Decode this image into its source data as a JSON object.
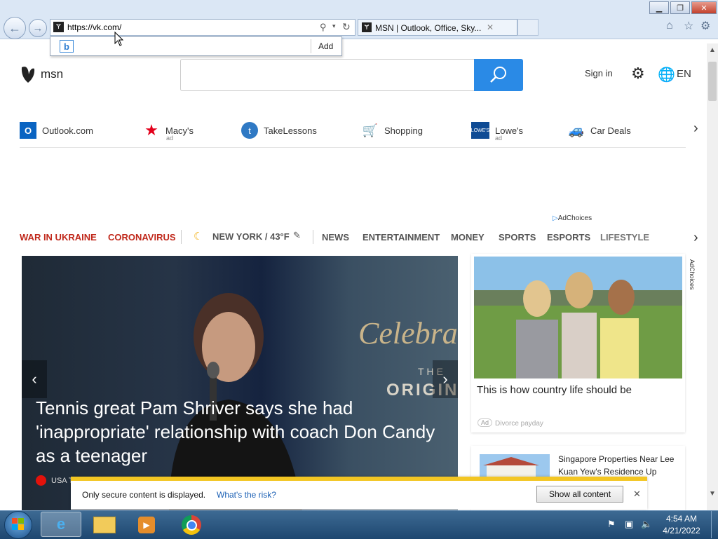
{
  "browser": {
    "address_url": "https://vk.com/",
    "tab_title": "MSN | Outlook, Office, Sky...",
    "suggest_add_label": "Add",
    "window_controls": [
      "minimize",
      "maximize",
      "close"
    ]
  },
  "msn": {
    "logo_text": "msn",
    "search_placeholder": "",
    "sign_in": "Sign in",
    "language": "EN",
    "quick_links": [
      {
        "label": "Outlook.com",
        "ad": ""
      },
      {
        "label": "Macy's",
        "ad": "ad"
      },
      {
        "label": "TakeLessons",
        "ad": ""
      },
      {
        "label": "Shopping",
        "ad": ""
      },
      {
        "label": "Lowe's",
        "ad": "ad"
      },
      {
        "label": "Car Deals",
        "ad": ""
      }
    ],
    "adchoices": "AdChoices",
    "nav": {
      "war": "WAR IN UKRAINE",
      "corona": "CORONAVIRUS",
      "weather": "NEW YORK / 43°F",
      "news": "NEWS",
      "entertainment": "ENTERTAINMENT",
      "money": "MONEY",
      "sports": "SPORTS",
      "esports": "ESPORTS",
      "lifestyle": "LIFESTYLE"
    },
    "hero": {
      "headline": "Tennis great Pam Shriver says she had 'inappropriate' relationship with coach Don Candy as a teenager",
      "source": "USA T",
      "backdrop_text": "Celebra",
      "backdrop_sub": "THE",
      "backdrop_sub2": "ORIGIN"
    },
    "card1": {
      "title": "This is how country life should be",
      "ad_badge": "Ad",
      "source": "Divorce payday"
    },
    "card2": {
      "title": "Singapore Properties Near Lee Kuan Yew's Residence Up ...ales..."
    },
    "side_adchoices": "AdChoices"
  },
  "infobar": {
    "message": "Only secure content is displayed.",
    "link": "What's the risk?",
    "button": "Show all content"
  },
  "taskbar": {
    "time": "4:54 AM",
    "date": "4/21/2022"
  }
}
